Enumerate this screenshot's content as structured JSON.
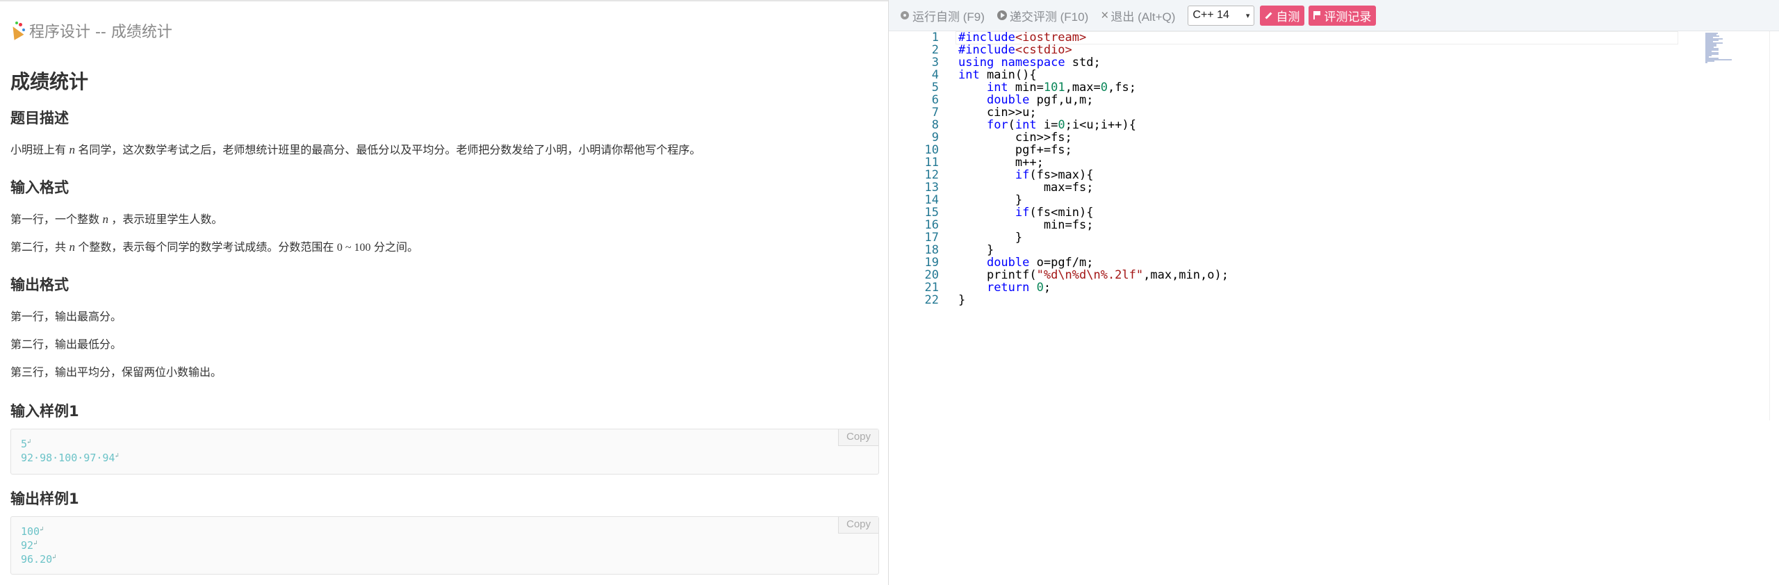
{
  "problem": {
    "page_title": "程序设计 -- 成绩统计",
    "title": "成绩统计",
    "desc_heading": "题目描述",
    "desc_text_1": "小明班上有",
    "desc_var": "n",
    "desc_text_2": "名同学，这次数学考试之后，老师想统计班里的最高分、最低分以及平均分。老师把分数发给了小明，小明请你帮他写个程序。",
    "input_heading": "输入格式",
    "input_line1_a": "第一行，一个整数",
    "input_line1_var": "n",
    "input_line1_b": "，表示班里学生人数。",
    "input_line2_a": "第二行，共",
    "input_line2_var": "n",
    "input_line2_b": "个整数，表示每个同学的数学考试成绩。分数范围在",
    "input_line2_range": "0 ~ 100",
    "input_line2_c": "分之间。",
    "output_heading": "输出格式",
    "output_line1": "第一行，输出最高分。",
    "output_line2": "第二行，输出最低分。",
    "output_line3": "第三行，输出平均分，保留两位小数输出。",
    "sample_in_heading": "输入样例1",
    "sample_in_lines": [
      "5",
      "92·98·100·97·94"
    ],
    "sample_out_heading": "输出样例1",
    "sample_out_lines": [
      "100",
      "92",
      "96.20"
    ],
    "copy_label": "Copy",
    "newline_mark": "↲"
  },
  "toolbar": {
    "run_label": "运行自测 (F9)",
    "submit_label": "递交评测 (F10)",
    "exit_label": "退出 (Alt+Q)",
    "language": "C++ 14",
    "selftest_label": "自测",
    "records_label": "评测记录",
    "accent_color": "#e9557a"
  },
  "editor": {
    "lines": [
      "#include<iostream>",
      "#include<cstdio>",
      "using namespace std;",
      "int main(){",
      "    int min=101,max=0,fs;",
      "    double pgf,u,m;",
      "    cin>>u;",
      "    for(int i=0;i<u;i++){",
      "        cin>>fs;",
      "        pgf+=fs;",
      "        m++;",
      "        if(fs>max){",
      "            max=fs;",
      "        }",
      "        if(fs<min){",
      "            min=fs;",
      "        }",
      "    }",
      "    double o=pgf/m;",
      "    printf(\"%d\\n%d\\n%.2lf\",max,min,o);",
      "    return 0;",
      "}"
    ]
  }
}
